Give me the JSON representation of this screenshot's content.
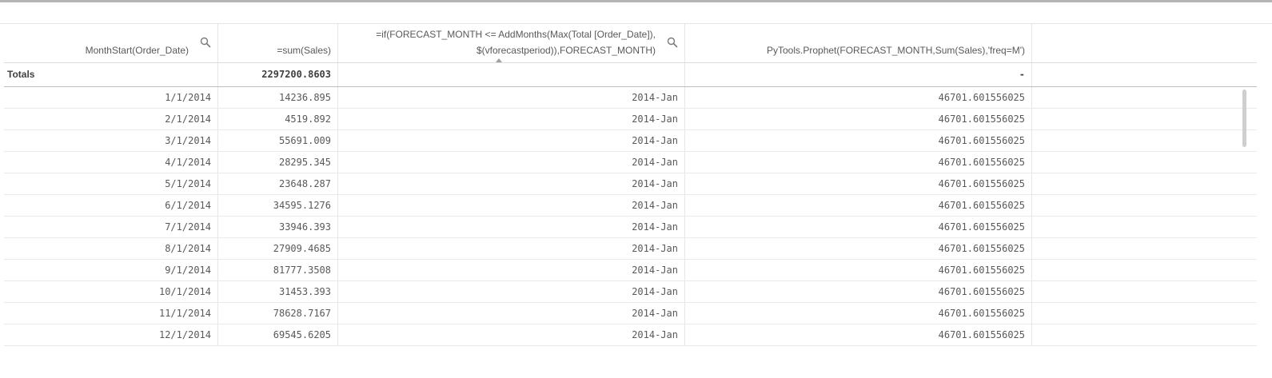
{
  "table": {
    "headers": [
      "MonthStart(Order_Date)",
      "=sum(Sales)",
      "=if(FORECAST_MONTH <= AddMonths(Max(Total [Order_Date]),",
      "PyTools.Prophet(FORECAST_MONTH,Sum(Sales),'freq=M')"
    ],
    "header3_line2": "$(vforecastperiod)),FORECAST_MONTH)",
    "totals": {
      "label": "Totals",
      "sum_sales": "2297200.8603",
      "forecast": "",
      "prophet": "-"
    },
    "rows": [
      [
        "1/1/2014",
        "14236.895",
        "2014-Jan",
        "46701.601556025"
      ],
      [
        "2/1/2014",
        "4519.892",
        "2014-Jan",
        "46701.601556025"
      ],
      [
        "3/1/2014",
        "55691.009",
        "2014-Jan",
        "46701.601556025"
      ],
      [
        "4/1/2014",
        "28295.345",
        "2014-Jan",
        "46701.601556025"
      ],
      [
        "5/1/2014",
        "23648.287",
        "2014-Jan",
        "46701.601556025"
      ],
      [
        "6/1/2014",
        "34595.1276",
        "2014-Jan",
        "46701.601556025"
      ],
      [
        "7/1/2014",
        "33946.393",
        "2014-Jan",
        "46701.601556025"
      ],
      [
        "8/1/2014",
        "27909.4685",
        "2014-Jan",
        "46701.601556025"
      ],
      [
        "9/1/2014",
        "81777.3508",
        "2014-Jan",
        "46701.601556025"
      ],
      [
        "10/1/2014",
        "31453.393",
        "2014-Jan",
        "46701.601556025"
      ],
      [
        "11/1/2014",
        "78628.7167",
        "2014-Jan",
        "46701.601556025"
      ],
      [
        "12/1/2014",
        "69545.6205",
        "2014-Jan",
        "46701.601556025"
      ]
    ]
  },
  "icons": {
    "search": "search-icon",
    "sort": "sort-ascending-icon"
  },
  "colors": {
    "text": "#595959",
    "totals_text": "#404040",
    "divider": "#e6e6e6",
    "scrollbar": "#cfcfcf"
  }
}
